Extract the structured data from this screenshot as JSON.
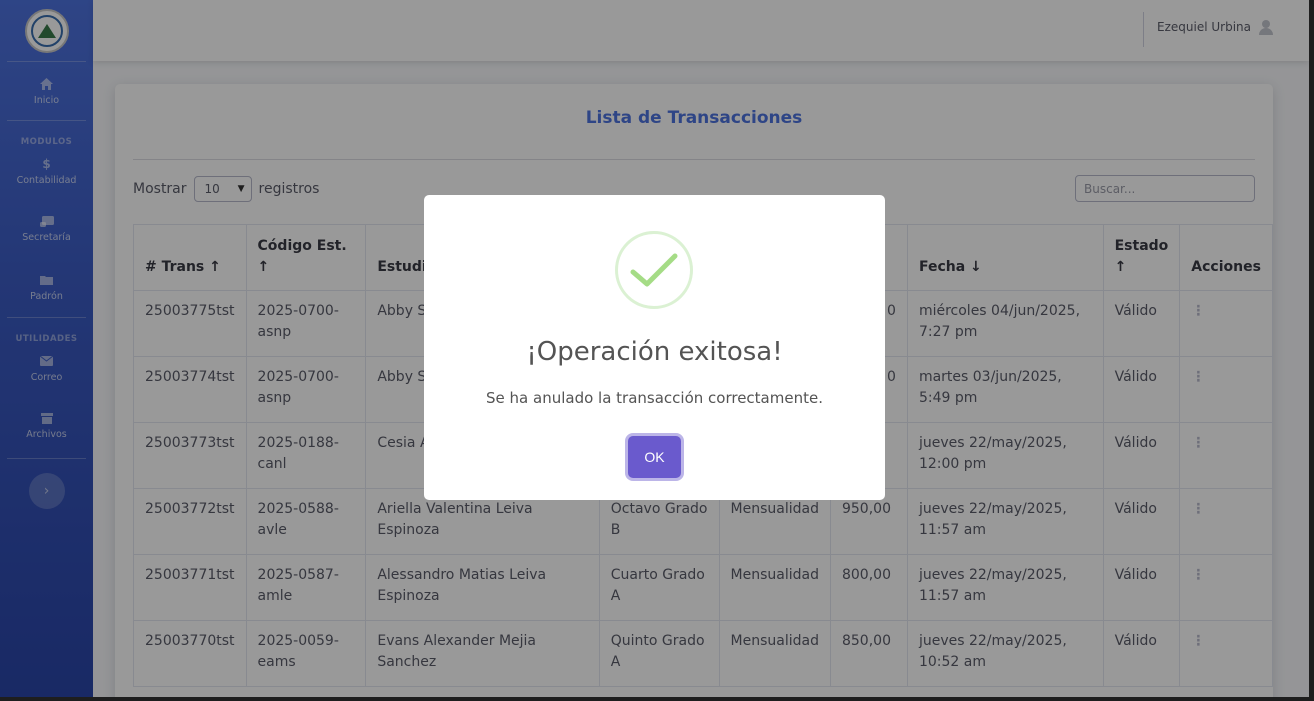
{
  "sidebar": {
    "items_top": [
      {
        "label": "Inicio",
        "icon": "home-icon"
      }
    ],
    "heading_modulos": "MODULOS",
    "items_modulos": [
      {
        "label": "Contabilidad",
        "icon": "dollar-icon"
      },
      {
        "label": "Secretaría",
        "icon": "scroll-icon"
      },
      {
        "label": "Padrón",
        "icon": "folder-icon"
      }
    ],
    "heading_utilidades": "UTILIDADES",
    "items_utilidades": [
      {
        "label": "Correo",
        "icon": "envelope-icon"
      },
      {
        "label": "Archivos",
        "icon": "archive-icon"
      }
    ]
  },
  "topbar": {
    "user_name": "Ezequiel Urbina"
  },
  "card": {
    "title": "Lista de Transacciones",
    "show_label": "Mostrar",
    "page_size": "10",
    "records_label": "registros",
    "search_placeholder": "Buscar..."
  },
  "table": {
    "headers": [
      "# Trans ↑",
      "Código Est. ↑",
      "Estudia",
      "",
      "",
      "",
      "Fecha ↓",
      "Estado ↑",
      "Acciones"
    ],
    "rows": [
      [
        "25003775tst",
        "2025-0700-asnp",
        "Abby St",
        "",
        "",
        "0",
        "miércoles 04/jun/2025, 7:27 pm",
        "Válido"
      ],
      [
        "25003774tst",
        "2025-0700-asnp",
        "Abby St",
        "",
        "",
        "0",
        "martes 03/jun/2025, 5:49 pm",
        "Válido"
      ],
      [
        "25003773tst",
        "2025-0188-canl",
        "Cesia A Leyton",
        "",
        "",
        "",
        "jueves 22/may/2025, 12:00 pm",
        "Válido"
      ],
      [
        "25003772tst",
        "2025-0588-avle",
        "Ariella Valentina Leiva Espinoza",
        "Octavo Grado B",
        "Mensualidad",
        "950,00",
        "jueves 22/may/2025, 11:57 am",
        "Válido"
      ],
      [
        "25003771tst",
        "2025-0587-amle",
        "Alessandro Matias Leiva Espinoza",
        "Cuarto Grado A",
        "Mensualidad",
        "800,00",
        "jueves 22/may/2025, 11:57 am",
        "Válido"
      ],
      [
        "25003770tst",
        "2025-0059-eams",
        "Evans Alexander Mejia Sanchez",
        "Quinto Grado A",
        "Mensualidad",
        "850,00",
        "jueves 22/may/2025, 10:52 am",
        "Válido"
      ]
    ]
  },
  "modal": {
    "title": "¡Operación exitosa!",
    "message": "Se ha anulado la transacción correctamente.",
    "ok_label": "OK",
    "success_color": "#a5dc86",
    "button_color": "#6a5acd"
  }
}
